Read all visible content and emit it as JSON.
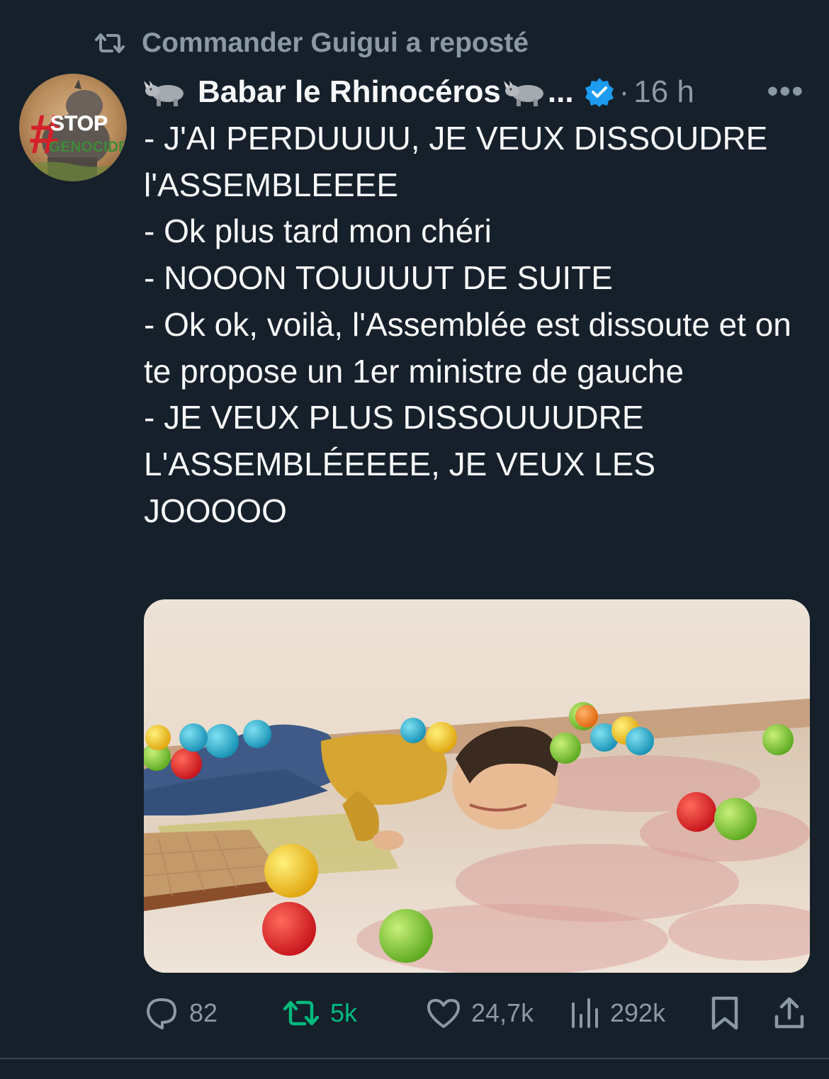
{
  "colors": {
    "background": "#15202b",
    "text_primary": "#f7f9f9",
    "text_secondary": "#8b98a5",
    "verified_blue": "#1d9bf0",
    "retweet_green": "#00ba7c",
    "divider": "#38444d"
  },
  "repost": {
    "icon": "repost-icon",
    "text": "Commander Guigui a reposté"
  },
  "author": {
    "avatar": {
      "badge_line1": "STOP",
      "badge_line2": "GENOCIDE",
      "hash": "#"
    },
    "name": "Babar le Rhinocéros",
    "name_prefix_emoji": "rhinoceros-emoji",
    "name_suffix_emoji": "rhinoceros-emoji",
    "truncation": "...",
    "verified_icon": "verified-badge-icon",
    "separator": "·",
    "time": "16 h",
    "more_icon": "more-icon",
    "more_label": "•••"
  },
  "tweet": {
    "text": "- J'AI PERDUUUU, JE VEUX DISSOUDRE l'ASSEMBLEEEE\n- Ok plus tard mon chéri\n- NOOON TOUUUUT DE SUITE\n- Ok ok, voilà, l'Assemblée est dissoute et on te propose un 1er ministre de gauche\n- JE VEUX PLUS DISSOUUUDRE L'ASSEMBLÉEEEE, JE VEUX LES JOOOOO"
  },
  "actions": {
    "replies": {
      "icon": "reply-icon",
      "count": "82"
    },
    "reposts": {
      "icon": "repost-icon",
      "count": "5k"
    },
    "likes": {
      "icon": "heart-icon",
      "count": "24,7k"
    },
    "views": {
      "icon": "views-chart-icon",
      "count": "292k"
    },
    "bookmark": {
      "icon": "bookmark-icon"
    },
    "share": {
      "icon": "share-icon"
    }
  }
}
